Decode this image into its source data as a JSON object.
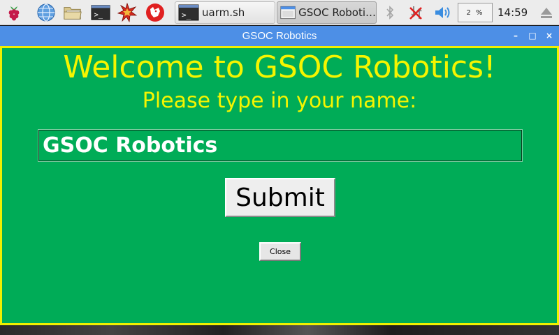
{
  "taskbar": {
    "launchers": [
      {
        "icon": "raspberry-menu-icon"
      },
      {
        "icon": "web-browser-icon"
      },
      {
        "icon": "file-manager-icon"
      },
      {
        "icon": "terminal-icon"
      },
      {
        "icon": "wolfram-mathematica-icon"
      },
      {
        "icon": "wolfram-language-icon"
      }
    ],
    "tasks": [
      {
        "label": "uarm.sh",
        "icon": "terminal-icon",
        "active": false
      },
      {
        "label": "GSOC Roboti…",
        "icon": "window-icon",
        "active": true
      }
    ],
    "tray": {
      "bluetooth_icon": "bluetooth-icon",
      "network_icon": "network-disconnected-icon",
      "volume_icon": "volume-icon",
      "cpu_usage": "2 %",
      "clock": "14:59",
      "eject_icon": "eject-icon"
    }
  },
  "window": {
    "title": "GSOC Robotics",
    "controls": {
      "minimize": "–",
      "maximize": "□",
      "close": "×"
    }
  },
  "app": {
    "heading": "Welcome to GSOC Robotics!",
    "prompt": "Please type in your name:",
    "name_value": "GSOC Robotics",
    "submit_label": "Submit",
    "close_label": "Close",
    "colors": {
      "background": "#00ac57",
      "border": "#f0f000",
      "heading": "#f5f500",
      "titlebar": "#4d8fe6"
    }
  }
}
